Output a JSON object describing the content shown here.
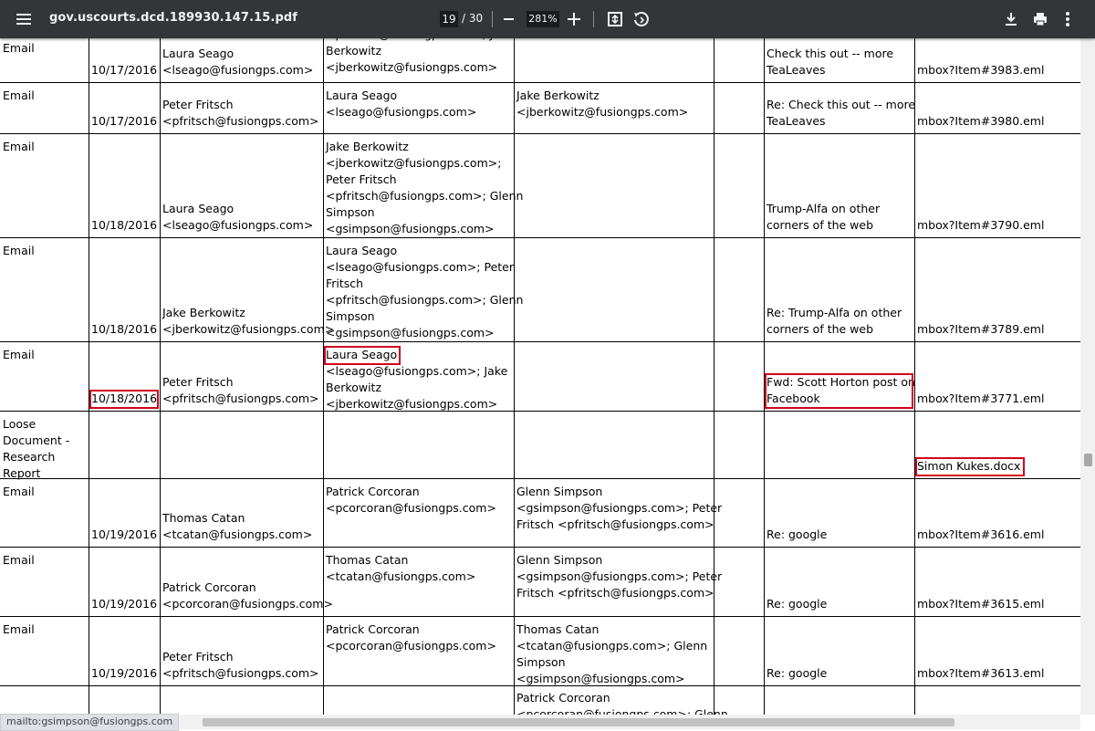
{
  "toolbar": {
    "title": "gov.uscourts.dcd.189930.147.15.pdf",
    "page_current": "19",
    "page_count": "/  30",
    "zoom": "281%",
    "icons": [
      "menu-icon",
      "zoom-out-icon",
      "zoom-in-icon",
      "fit-page-icon",
      "rotate-icon",
      "download-icon",
      "print-icon",
      "more-vert-icon"
    ]
  },
  "status_bar": {
    "link": "mailto:gsimpson@fusiongps.com"
  },
  "scroll": {
    "vertical_position": 0.55,
    "horizontal_visible_fraction": 0.7
  },
  "highlight_color": "#d0021b",
  "table": {
    "rows": [
      {
        "type": "Email",
        "date": "10/17/2016",
        "from": "Laura Seago\n<lseago@fusiongps.com>",
        "to": "<pfritsch@fusiongps.com>; Jake\nBerkowitz\n<jberkowitz@fusiongps.com>",
        "cc": "",
        "bcc": "",
        "subject": "Check this out -- more\nTeaLeaves",
        "file": "mbox?Item#3983.eml"
      },
      {
        "type": "Email",
        "date": "10/17/2016",
        "from": "Peter Fritsch\n<pfritsch@fusiongps.com>",
        "to": "Laura Seago\n<lseago@fusiongps.com>",
        "cc": "Jake Berkowitz\n<jberkowitz@fusiongps.com>",
        "bcc": "",
        "subject": "Re: Check this out -- more\nTeaLeaves",
        "file": "mbox?Item#3980.eml"
      },
      {
        "type": "Email",
        "date": "10/18/2016",
        "from": "Laura Seago\n<lseago@fusiongps.com>",
        "to": "Jake Berkowitz\n<jberkowitz@fusiongps.com>;\nPeter Fritsch\n<pfritsch@fusiongps.com>; Glenn\nSimpson\n<gsimpson@fusiongps.com>",
        "cc": "",
        "bcc": "",
        "subject": "Trump-Alfa on other\ncorners of the web",
        "file": "mbox?Item#3790.eml"
      },
      {
        "type": "Email",
        "date": "10/18/2016",
        "from": "Jake Berkowitz\n<jberkowitz@fusiongps.com>",
        "to": "Laura Seago\n<lseago@fusiongps.com>; Peter\nFritsch\n<pfritsch@fusiongps.com>; Glenn\nSimpson\n<gsimpson@fusiongps.com>",
        "cc": "",
        "bcc": "",
        "subject": "Re: Trump-Alfa on other\ncorners of the web",
        "file": "mbox?Item#3789.eml"
      },
      {
        "type": "Email",
        "date": "10/18/2016",
        "from": "Peter Fritsch\n<pfritsch@fusiongps.com>",
        "to": "Laura Seago\n<lseago@fusiongps.com>; Jake\nBerkowitz\n<jberkowitz@fusiongps.com>",
        "cc": "",
        "bcc": "",
        "subject": "Fwd: Scott Horton post on\nFacebook",
        "file": "mbox?Item#3771.eml"
      },
      {
        "type": "Loose\nDocument -\nResearch\nReport",
        "date": "",
        "from": "",
        "to": "",
        "cc": "",
        "bcc": "",
        "subject": "",
        "file": "Simon Kukes.docx"
      },
      {
        "type": "Email",
        "date": "10/19/2016",
        "from": "Thomas Catan\n<tcatan@fusiongps.com>",
        "to": "Patrick Corcoran\n<pcorcoran@fusiongps.com>",
        "cc": "Glenn Simpson\n<gsimpson@fusiongps.com>; Peter\nFritsch <pfritsch@fusiongps.com>",
        "bcc": "",
        "subject": "Re: google",
        "file": "mbox?Item#3616.eml"
      },
      {
        "type": "Email",
        "date": "10/19/2016",
        "from": "Patrick Corcoran\n<pcorcoran@fusiongps.com>",
        "to": "Thomas Catan\n<tcatan@fusiongps.com>",
        "cc": "Glenn Simpson\n<gsimpson@fusiongps.com>; Peter\nFritsch <pfritsch@fusiongps.com>",
        "bcc": "",
        "subject": "Re: google",
        "file": "mbox?Item#3615.eml"
      },
      {
        "type": "Email",
        "date": "10/19/2016",
        "from": "Peter Fritsch\n<pfritsch@fusiongps.com>",
        "to": "Patrick Corcoran\n<pcorcoran@fusiongps.com>",
        "cc": "Thomas Catan\n<tcatan@fusiongps.com>; Glenn\nSimpson\n<gsimpson@fusiongps.com>",
        "bcc": "",
        "subject": "Re: google",
        "file": "mbox?Item#3613.eml"
      },
      {
        "type": "",
        "date": "",
        "from": "",
        "to": "",
        "cc": "Patrick Corcoran\n<pcorcoran@fusiongps.com>; Glenn",
        "bcc": "",
        "subject": "",
        "file": ""
      }
    ]
  }
}
